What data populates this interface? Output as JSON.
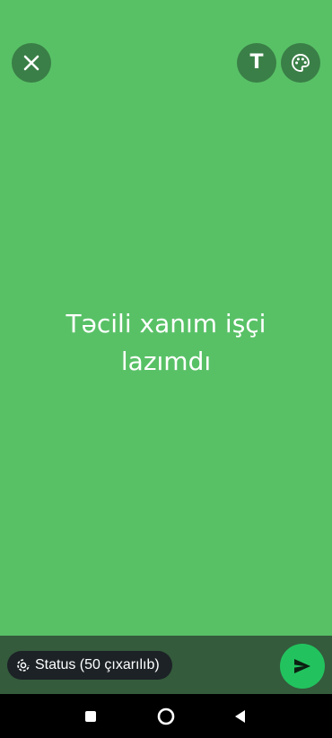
{
  "colors": {
    "background": "#58c166",
    "top_button_bg": "#3a7f47",
    "bottom_bar_bg": "#345b3c",
    "chip_bg": "#1c2226",
    "send_button_bg": "#22c35e",
    "nav_bar_bg": "#000000"
  },
  "toolbar": {
    "close_icon": "close-icon",
    "text_button_glyph": "T",
    "palette_icon": "palette-icon"
  },
  "status": {
    "text": "Təcili xanım işçi lazımdı"
  },
  "footer": {
    "audience_label": "Status (50 çıxarılıb)",
    "audience_icon": "status-ring-icon",
    "send_icon": "send-icon"
  },
  "nav": {
    "recents_icon": "square-icon",
    "home_icon": "circle-icon",
    "back_icon": "triangle-back-icon"
  }
}
